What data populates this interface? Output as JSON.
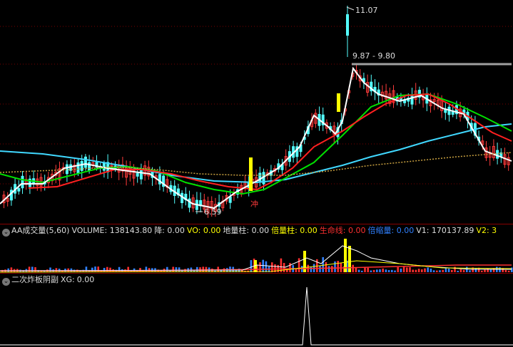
{
  "main_chart": {
    "labels": {
      "high_price": "11.07",
      "price_range": "9.87 - 9.80",
      "low_price": "6.59",
      "signal_char": "冲"
    },
    "colors": {
      "up": "#ff3b3b",
      "down": "#54ffff",
      "ma_white": "#ffffff",
      "ma_red": "#ff2020",
      "ma_green": "#00e000",
      "ma_cyan": "#40d8ff",
      "dotted": "#c8a040",
      "signal_bar": "#ffff00",
      "resistance": "#a0a0a0"
    }
  },
  "volume_panel": {
    "title": "AA成交量(5,60)",
    "fields": [
      {
        "label": "VOLUME:",
        "value": "138143.80",
        "color": "#dddddd"
      },
      {
        "label": "降:",
        "value": "0.00",
        "color": "#dddddd"
      },
      {
        "label": "VO:",
        "value": "0.00",
        "color": "#ffff00"
      },
      {
        "label": "地量柱:",
        "value": "0.00",
        "color": "#dddddd"
      },
      {
        "label": "倍量柱:",
        "value": "0.00",
        "color": "#ffff00"
      },
      {
        "label": "生命线:",
        "value": "0.00",
        "color": "#ff3030"
      },
      {
        "label": "倍缩量:",
        "value": "0.00",
        "color": "#3080ff"
      },
      {
        "label": "V1:",
        "value": "170137.89",
        "color": "#dddddd"
      },
      {
        "label": "V2:",
        "value": "3",
        "color": "#ffff00"
      }
    ]
  },
  "xg_panel": {
    "title": "二次炸板阴副",
    "field": {
      "label": "XG:",
      "value": "0.00"
    }
  }
}
